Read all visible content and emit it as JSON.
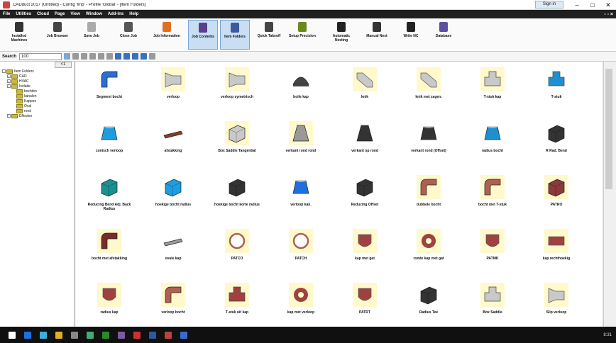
{
  "window": {
    "title": "CADduct 2017 (Untitled) - Config 'Imp' - Profile 'Global' - [Item Folders]",
    "signin": "Sign in",
    "min": "–",
    "max": "□",
    "close": "✕"
  },
  "menu": {
    "items": [
      "File",
      "Utilities",
      "Cloud",
      "Page",
      "View",
      "Window",
      "Add-Ins",
      "Help"
    ],
    "right": "- ▫ ×"
  },
  "ribbon": {
    "buttons": [
      {
        "label": "Installed Machines",
        "color": "#333"
      },
      {
        "label": "Job Browser",
        "color": "#444"
      },
      {
        "label": "Save Job",
        "color": "#aaa"
      },
      {
        "label": "Close Job",
        "color": "#555"
      },
      {
        "label": "Job Information",
        "color": "#e07020"
      },
      {
        "label": "Job Contents",
        "color": "#5a3f8f"
      },
      {
        "label": "Item Folders",
        "color": "#3b59a0"
      },
      {
        "label": "Quick Takeoff",
        "color": "#444"
      },
      {
        "label": "Setup Precision",
        "color": "#6a8a20"
      },
      {
        "label": "Automatic Nesting",
        "color": "#222"
      },
      {
        "label": "Manual Nest",
        "color": "#333"
      },
      {
        "label": "Write NC",
        "color": "#222"
      },
      {
        "label": "Database",
        "color": "#5a4fa0"
      }
    ]
  },
  "toolbar": {
    "search_label": "Search",
    "search_value": "100"
  },
  "tree": {
    "header_btn": "<1",
    "items": [
      {
        "label": "Item Folders",
        "level": 0,
        "expander": "-"
      },
      {
        "label": "CAD",
        "level": 1,
        "expander": "+"
      },
      {
        "label": "HVAC",
        "level": 1,
        "expander": "+"
      },
      {
        "label": "Isolatie",
        "level": 1,
        "expander": "-"
      },
      {
        "label": "bochten",
        "level": 2,
        "expander": ""
      },
      {
        "label": "kanalen",
        "level": 2,
        "expander": ""
      },
      {
        "label": "Kappen",
        "level": 2,
        "expander": ""
      },
      {
        "label": "Oval",
        "level": 2,
        "expander": ""
      },
      {
        "label": "rond",
        "level": 2,
        "expander": ""
      },
      {
        "label": "Effecten",
        "level": 1,
        "expander": "+"
      }
    ]
  },
  "grid": {
    "items": [
      {
        "label": "Segment bocht",
        "shape": "elbow",
        "color": "#2a6fd6",
        "bg": false
      },
      {
        "label": "verloop",
        "shape": "transition",
        "color": "#c9c9c9",
        "bg": true
      },
      {
        "label": "verloop symetrisch",
        "shape": "transition",
        "color": "#c9c9c9",
        "bg": true
      },
      {
        "label": "boile kap",
        "shape": "dome",
        "color": "#444",
        "bg": false
      },
      {
        "label": "knik",
        "shape": "offset",
        "color": "#c9c9c9",
        "bg": true
      },
      {
        "label": "knik met zagen.",
        "shape": "offset",
        "color": "#c9c9c9",
        "bg": true
      },
      {
        "label": "T-stuk kap",
        "shape": "tee",
        "color": "#c9c9c9",
        "bg": true
      },
      {
        "label": "T-stuk",
        "shape": "tee",
        "color": "#1e8fd0",
        "bg": false
      },
      {
        "label": "conisch verloop",
        "shape": "cone",
        "color": "#1e9ee0",
        "bg": false
      },
      {
        "label": "afstakking",
        "shape": "flat",
        "color": "#8a3a2a",
        "bg": false
      },
      {
        "label": "Box Saddle Tangential",
        "shape": "box",
        "color": "#c9c9c9",
        "bg": true
      },
      {
        "label": "verkant rond rond",
        "shape": "pyramid",
        "color": "#999",
        "bg": true
      },
      {
        "label": "verkant op rond",
        "shape": "pyramid",
        "color": "#333",
        "bg": false
      },
      {
        "label": "verkant rond (Offset)",
        "shape": "cone",
        "color": "#333",
        "bg": false
      },
      {
        "label": "radius bocht",
        "shape": "cone",
        "color": "#1e8fd0",
        "bg": false
      },
      {
        "label": "R Rad. Bend",
        "shape": "box",
        "color": "#333",
        "bg": false
      },
      {
        "label": "Reducing Bend Adj. Back Radius",
        "shape": "box",
        "color": "#1a9090",
        "bg": false
      },
      {
        "label": "hoekige bocht radius",
        "shape": "box",
        "color": "#1e9ee0",
        "bg": false
      },
      {
        "label": "hoekige bocht korte radius",
        "shape": "box",
        "color": "#333",
        "bg": false
      },
      {
        "label": "verloop kan.",
        "shape": "cone",
        "color": "#1e6fe0",
        "bg": false
      },
      {
        "label": "Reducing Offset",
        "shape": "box",
        "color": "#333",
        "bg": false
      },
      {
        "label": "dubbele bocht",
        "shape": "elbow",
        "color": "#b06050",
        "bg": true
      },
      {
        "label": "bocht met T-stuk",
        "shape": "elbow",
        "color": "#b06050",
        "bg": true
      },
      {
        "label": "PATRO",
        "shape": "box",
        "color": "#8a3a3a",
        "bg": true
      },
      {
        "label": "bocht met afstakking",
        "shape": "elbow",
        "color": "#7a2a2a",
        "bg": true
      },
      {
        "label": "ovale kap",
        "shape": "flat",
        "color": "#999",
        "bg": false
      },
      {
        "label": "PATCO",
        "shape": "circle",
        "color": "#b06050",
        "bg": true
      },
      {
        "label": "PATCH",
        "shape": "circle",
        "color": "#b06050",
        "bg": true
      },
      {
        "label": "kap met gat",
        "shape": "shield",
        "color": "#a04040",
        "bg": true
      },
      {
        "label": "ronde kap met gat",
        "shape": "ring",
        "color": "#a04040",
        "bg": true
      },
      {
        "label": "PATMK",
        "shape": "shield",
        "color": "#a04040",
        "bg": true
      },
      {
        "label": "kap rechthoekig",
        "shape": "rect",
        "color": "#a04040",
        "bg": true
      },
      {
        "label": "radius kap",
        "shape": "shield",
        "color": "#a04040",
        "bg": true
      },
      {
        "label": "verloop bocht",
        "shape": "elbow",
        "color": "#b06050",
        "bg": true
      },
      {
        "label": "T-stuk uit kap",
        "shape": "tee",
        "color": "#a04040",
        "bg": true
      },
      {
        "label": "kap met verloop",
        "shape": "ring",
        "color": "#a04040",
        "bg": true
      },
      {
        "label": "PATRT",
        "shape": "shield",
        "color": "#a04040",
        "bg": true
      },
      {
        "label": "Radius Tee",
        "shape": "box",
        "color": "#333",
        "bg": false
      },
      {
        "label": "Box Saddle",
        "shape": "tee",
        "color": "#c9c9c9",
        "bg": true
      },
      {
        "label": "Slip verloop",
        "shape": "transition",
        "color": "#c9c9c9",
        "bg": true
      }
    ]
  },
  "taskbar": {
    "icons": [
      "#1e6fd6",
      "#3ab0e0",
      "#e0b020",
      "#888",
      "#4a7",
      "#2a8a2a",
      "#7a5aa0",
      "#d03030",
      "#2a5aa0",
      "#c04040",
      "#3a6ad0"
    ],
    "clock": "8:31"
  }
}
